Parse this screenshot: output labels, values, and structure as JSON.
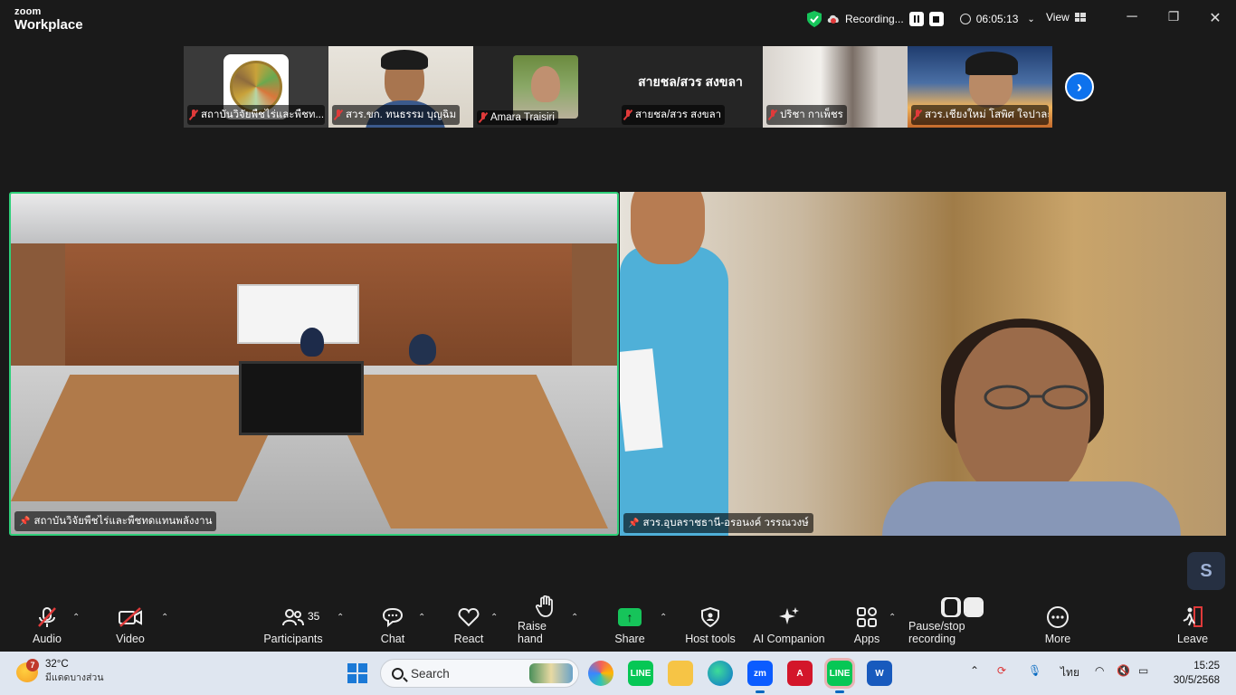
{
  "app": {
    "brand_small": "zoom",
    "brand_large": "Workplace"
  },
  "titlebar": {
    "recording_label": "Recording...",
    "timer": "06:05:13",
    "view_label": "View"
  },
  "filmstrip": [
    {
      "name": "สถาบันวิจัยพืชไร่และพืชท..."
    },
    {
      "name": "สวร.ขก. ทนธรรม บุญฉิม"
    },
    {
      "name": "Amara Traisiri"
    },
    {
      "name": "สายชล/สวร สงขลา",
      "display_text": "สายชล/สวร สงขลา"
    },
    {
      "name": "ปริชา กาเพ็ชร"
    },
    {
      "name": "สวร.เชียงใหม่ โสพิศ ใจปาละ"
    }
  ],
  "main_videos": {
    "left_name": "สถาบันวิจัยพืชไร่และพืชทดแทนพลังงาน",
    "right_name": "สวร.อุบลราชธานี-อรอนงค์ วรรณวงษ์"
  },
  "toolbar": {
    "audio": "Audio",
    "video": "Video",
    "participants": "Participants",
    "participants_count": "35",
    "chat": "Chat",
    "react": "React",
    "raise_hand": "Raise hand",
    "share": "Share",
    "host_tools": "Host tools",
    "ai_companion": "AI Companion",
    "apps": "Apps",
    "pause_stop": "Pause/stop recording",
    "more": "More",
    "leave": "Leave"
  },
  "taskbar": {
    "weather_badge": "7",
    "temperature": "32°C",
    "weather_desc": "มีแดดบางส่วน",
    "search_placeholder": "Search",
    "lang": "ไทย",
    "time": "15:25",
    "date": "30/5/2568"
  },
  "colors": {
    "active_speaker_border": "#2fd07a",
    "share_green": "#16c45a",
    "next_blue": "#0e72ed",
    "mic_off_red": "#e03a3a"
  }
}
